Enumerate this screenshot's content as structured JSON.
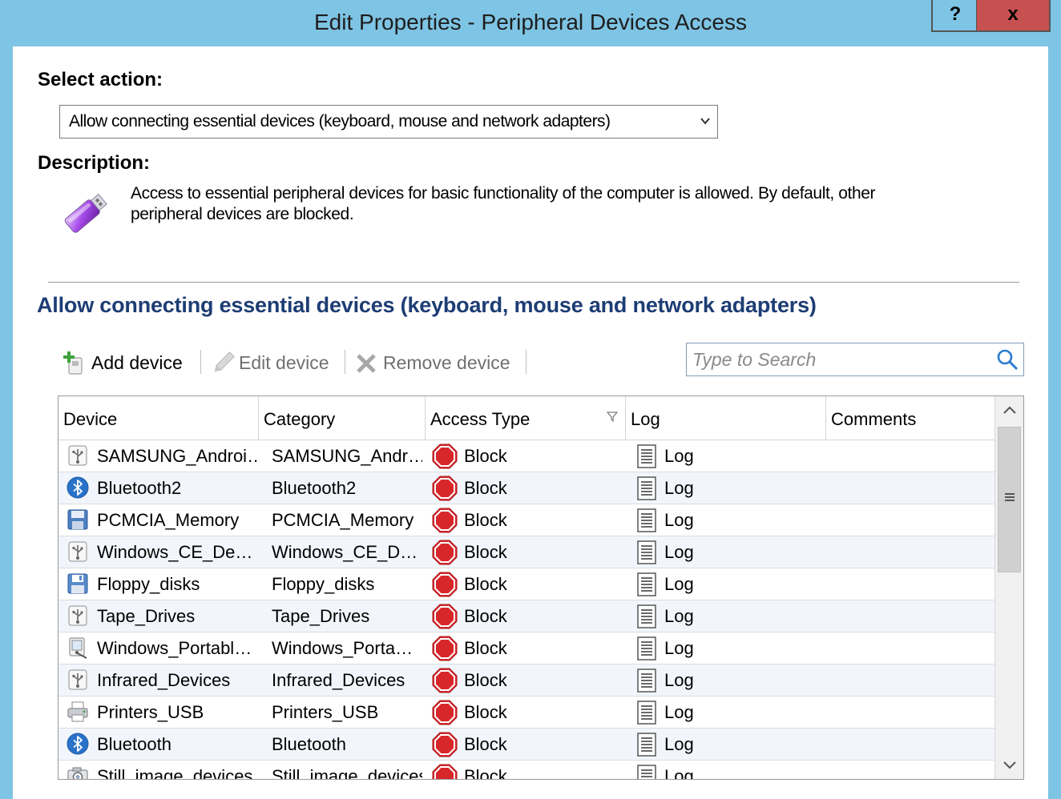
{
  "window": {
    "title": "Edit Properties - Peripheral Devices Access",
    "help_label": "?",
    "close_label": "x"
  },
  "select_action": {
    "label": "Select action:",
    "value": "Allow connecting essential devices (keyboard, mouse and network adapters)"
  },
  "description": {
    "label": "Description:",
    "text": "Access to essential peripheral devices for basic functionality of the computer is allowed. By default, other peripheral devices are blocked."
  },
  "section_title": "Allow connecting essential devices (keyboard, mouse and network adapters)",
  "toolbar": {
    "add_label": "Add device",
    "edit_label": "Edit device",
    "remove_label": "Remove device",
    "search_placeholder": "Type to Search"
  },
  "table": {
    "columns": [
      "Device",
      "Category",
      "Access Type",
      "Log",
      "Comments"
    ],
    "rows": [
      {
        "icon": "usb-icon",
        "device": "SAMSUNG_Androi…",
        "category": "SAMSUNG_Andr…",
        "access": "Block",
        "log": "Log",
        "comments": ""
      },
      {
        "icon": "bluetooth-icon",
        "device": "Bluetooth2",
        "category": "Bluetooth2",
        "access": "Block",
        "log": "Log",
        "comments": ""
      },
      {
        "icon": "memory-card-icon",
        "device": "PCMCIA_Memory",
        "category": "PCMCIA_Memory",
        "access": "Block",
        "log": "Log",
        "comments": ""
      },
      {
        "icon": "usb-icon",
        "device": "Windows_CE_De…",
        "category": "Windows_CE_D…",
        "access": "Block",
        "log": "Log",
        "comments": ""
      },
      {
        "icon": "floppy-disk-icon",
        "device": "Floppy_disks",
        "category": "Floppy_disks",
        "access": "Block",
        "log": "Log",
        "comments": ""
      },
      {
        "icon": "usb-icon",
        "device": "Tape_Drives",
        "category": "Tape_Drives",
        "access": "Block",
        "log": "Log",
        "comments": ""
      },
      {
        "icon": "portable-device-icon",
        "device": "Windows_Portabl…",
        "category": "Windows_Porta…",
        "access": "Block",
        "log": "Log",
        "comments": ""
      },
      {
        "icon": "usb-icon",
        "device": "Infrared_Devices",
        "category": "Infrared_Devices",
        "access": "Block",
        "log": "Log",
        "comments": ""
      },
      {
        "icon": "printer-icon",
        "device": "Printers_USB",
        "category": "Printers_USB",
        "access": "Block",
        "log": "Log",
        "comments": ""
      },
      {
        "icon": "bluetooth-icon",
        "device": "Bluetooth",
        "category": "Bluetooth",
        "access": "Block",
        "log": "Log",
        "comments": ""
      },
      {
        "icon": "camera-icon",
        "device": "Still_image_devices",
        "category": "Still_image_devices",
        "access": "Block",
        "log": "Log",
        "comments": ""
      }
    ]
  },
  "colors": {
    "title_bar": "#7ec4e4",
    "close_button": "#c75050",
    "section_title": "#1d3d74",
    "block": "#d8272b",
    "alt_row": "#f2f6fc"
  }
}
